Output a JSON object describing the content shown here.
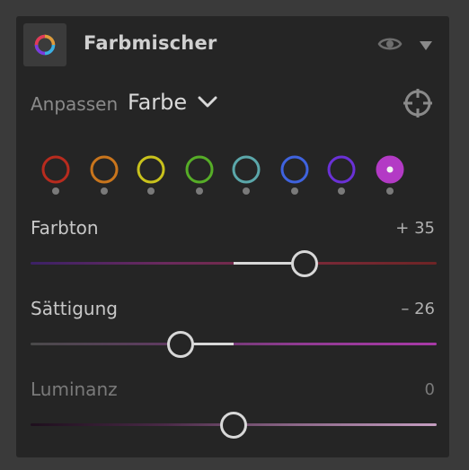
{
  "panel": {
    "title": "Farbmischer",
    "icon": "color-wheel-icon",
    "header_actions": [
      "eye-icon",
      "caret-down-icon"
    ]
  },
  "adjust": {
    "label": "Anpassen",
    "value": "Farbe",
    "target_tool_icon": "target-crosshair-icon"
  },
  "colors": {
    "swatches": [
      {
        "name": "red",
        "color": "#b82b1e",
        "selected": false
      },
      {
        "name": "orange",
        "color": "#c9751c",
        "selected": false
      },
      {
        "name": "yellow",
        "color": "#c9c21c",
        "selected": false
      },
      {
        "name": "green",
        "color": "#56ad27",
        "selected": false
      },
      {
        "name": "aqua",
        "color": "#5ba7aa",
        "selected": false
      },
      {
        "name": "blue",
        "color": "#3f63df",
        "selected": false
      },
      {
        "name": "purple",
        "color": "#6a31d6",
        "selected": false
      },
      {
        "name": "magenta",
        "color": "#b33ac5",
        "selected": true
      }
    ]
  },
  "sliders": [
    {
      "id": "hue",
      "label": "Farbton",
      "display": "+ 35",
      "value": 35,
      "min": -100,
      "max": 100,
      "label_color": "#c8c8c8",
      "gradient": [
        "#3c2166",
        "#6b2a5d",
        "#7a2a3a",
        "#6e2425"
      ]
    },
    {
      "id": "saturation",
      "label": "Sättigung",
      "display": "– 26",
      "value": -26,
      "min": -100,
      "max": 100,
      "label_color": "#c8c8c8",
      "gradient": [
        "#4a4a4a",
        "#5e3a60",
        "#913b93",
        "#a83aa7"
      ]
    },
    {
      "id": "luminance",
      "label": "Luminanz",
      "display": "0",
      "value": 0,
      "min": -100,
      "max": 100,
      "label_color": "#7a7a7a",
      "gradient": [
        "#1e0f1d",
        "#4a2a47",
        "#8f6a8b",
        "#c59ec1"
      ]
    }
  ]
}
